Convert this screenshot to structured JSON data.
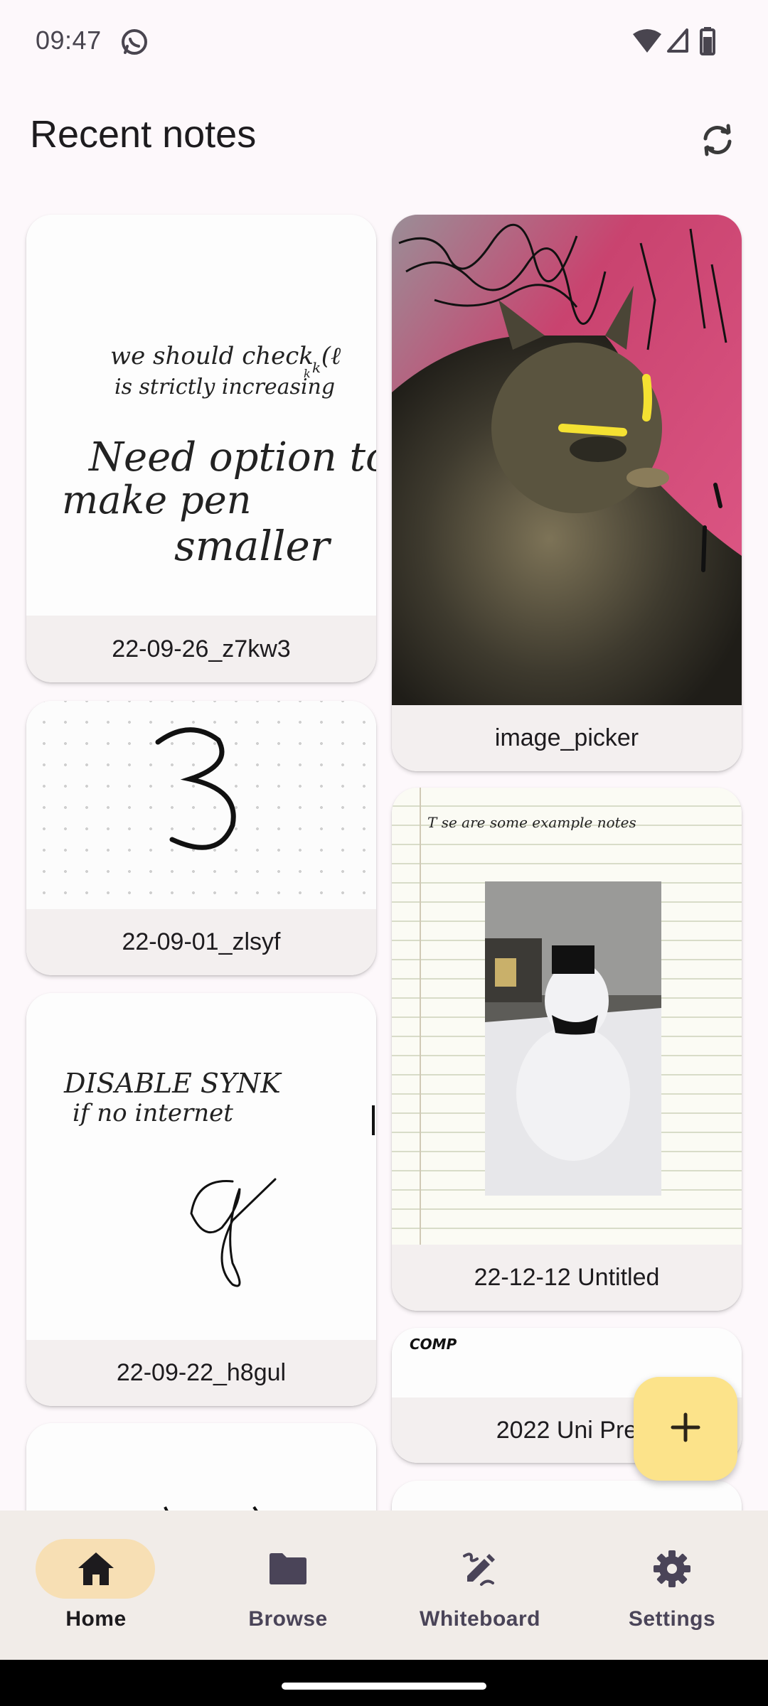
{
  "status_bar": {
    "time": "09:47"
  },
  "header": {
    "title": "Recent notes"
  },
  "notes": [
    {
      "label": "22-09-26_z7kw3",
      "lines": [
        "we should check (ℓ",
        "is strictly increasing",
        "Need option to",
        "make pen",
        "smaller"
      ],
      "sub": "k",
      "sub2": "k"
    },
    {
      "label": "image_picker"
    },
    {
      "label": "22-09-01_zlsyf"
    },
    {
      "label": "22-12-12 Untitled",
      "lines": [
        "T se are some example notes"
      ]
    },
    {
      "label": "22-09-22_h8gul",
      "lines": [
        "DISABLE SYNK",
        "if no internet"
      ]
    },
    {
      "label": "2022 Uni Pre",
      "lines": [
        "COMP"
      ]
    }
  ],
  "nav": {
    "items": [
      {
        "label": "Home",
        "icon": "home-icon",
        "active": true
      },
      {
        "label": "Browse",
        "icon": "folder-icon",
        "active": false
      },
      {
        "label": "Whiteboard",
        "icon": "draw-icon",
        "active": false
      },
      {
        "label": "Settings",
        "icon": "gear-icon",
        "active": false
      }
    ]
  },
  "colors": {
    "background": "#fdf8fb",
    "card_label_bg": "#f3efef",
    "fab": "#fce38a",
    "nav_bg": "#f1ece8",
    "nav_active_pill": "#f7dfb4"
  }
}
